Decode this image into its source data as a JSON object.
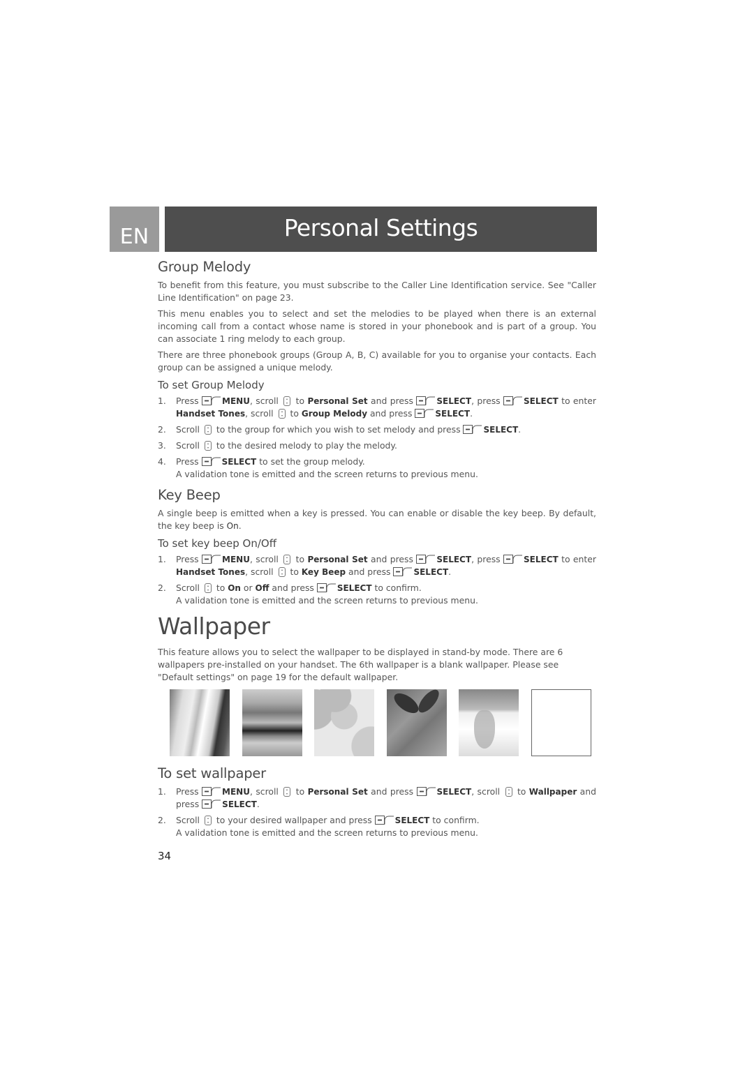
{
  "header": {
    "language_badge": "EN",
    "chapter_title": "Personal Settings"
  },
  "sections": {
    "group_melody": {
      "heading": "Group Melody",
      "paragraphs": [
        "To benefit from this feature, you must subscribe to the Caller Line Identification service. See \"Caller Line Identification\" on page 23.",
        "This menu enables you to select and set the melodies to be played when there is an external incoming call from a contact whose name is stored in your phonebook and is part of a group. You can associate 1 ring melody to each group.",
        "There are three phonebook groups (Group A, B, C) available for you to organise your contacts. Each group can be assigned a unique melody."
      ],
      "subheading": "To set Group Melody",
      "steps": {
        "s1": {
          "num": "1.",
          "t1": "Press ",
          "k1": "MENU",
          "t2": ", scroll ",
          "t3": " to ",
          "k2": "Personal Set",
          "t4": " and press ",
          "k3": "SELECT",
          "t5": ", press ",
          "k4": "SELECT",
          "t6": " to enter ",
          "k5": "Handset Tones",
          "t7": ", scroll ",
          "t8": " to ",
          "k6": "Group Melody",
          "t9": " and press ",
          "k7": "SELECT",
          "t10": "."
        },
        "s2": {
          "num": "2.",
          "t1": "Scroll ",
          "t2": " to the group for which you wish to set melody and press ",
          "k1": "SELECT",
          "t3": "."
        },
        "s3": {
          "num": "3.",
          "t1": "Scroll ",
          "t2": " to the desired melody to play the melody."
        },
        "s4": {
          "num": "4.",
          "t1": "Press ",
          "k1": "SELECT",
          "t2": " to set the group melody.",
          "note": "A validation tone is emitted and the screen returns to previous menu."
        }
      }
    },
    "key_beep": {
      "heading": "Key Beep",
      "paragraph_pre": "A single beep is emitted when a key is pressed. You can enable or disable the key beep. By default, the key beep is ",
      "paragraph_on": "On",
      "paragraph_post": ".",
      "subheading": "To set key beep On/Off",
      "steps": {
        "s1": {
          "num": "1.",
          "t1": "Press ",
          "k1": "MENU",
          "t2": ", scroll ",
          "t3": " to ",
          "k2": "Personal Set",
          "t4": " and press ",
          "k3": "SELECT",
          "t5": ", press ",
          "k4": "SELECT",
          "t6": " to enter ",
          "k5": "Handset Tones",
          "t7": ", scroll ",
          "t8": " to ",
          "k6": "Key Beep",
          "t9": " and press ",
          "k7": "SELECT",
          "t10": "."
        },
        "s2": {
          "num": "2.",
          "t1": "Scroll ",
          "t2": " to ",
          "k1": "On",
          "t3": " or ",
          "k2": "Off",
          "t4": " and press ",
          "k3": "SELECT",
          "t5": " to confirm.",
          "note": "A validation tone is emitted and the screen returns to previous menu."
        }
      }
    },
    "wallpaper": {
      "heading": "Wallpaper",
      "paragraph": "This feature allows you to select the wallpaper to be displayed in stand-by mode. There are 6 wallpapers pre-installed on your handset. The 6th wallpaper is a blank wallpaper. Please see \"Default settings\" on page 19 for the default wallpaper.",
      "thumbnails": [
        "glass",
        "pier-sunset",
        "smiley-balls",
        "butterfly-flower",
        "water-splash",
        "blank"
      ],
      "subheading": "To set wallpaper",
      "steps": {
        "s1": {
          "num": "1.",
          "t1": "Press ",
          "k1": "MENU",
          "t2": ", scroll ",
          "t3": " to ",
          "k2": "Personal Set",
          "t4": " and press ",
          "k3": "SELECT",
          "t5": ", scroll ",
          "t6": " to ",
          "k4": "Wallpaper",
          "t7": " and press ",
          "k5": "SELECT",
          "t8": "."
        },
        "s2": {
          "num": "2.",
          "t1": "Scroll ",
          "t2": " to your desired wallpaper and press ",
          "k1": "SELECT",
          "t3": " to confirm.",
          "note": "A validation tone is emitted and the screen returns to previous menu."
        }
      }
    }
  },
  "footer": {
    "page_number": "34"
  }
}
